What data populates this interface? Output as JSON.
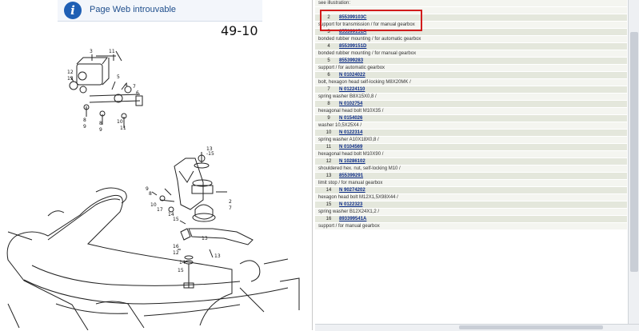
{
  "banner": {
    "message": "Page Web introuvable",
    "icon": "info-icon"
  },
  "diagram": {
    "page_label": "49-10"
  },
  "parts": {
    "intro": "see illustration:",
    "items": [
      {
        "num": "2",
        "part": "855399103C",
        "desc": "support for transmission / for manual gearbox"
      },
      {
        "num": "3",
        "part": "855399151A",
        "desc": "bonded rubber mounting / for automatic gearbox"
      },
      {
        "num": "4",
        "part": "855399151D",
        "desc": "bonded rubber mounting / for manual gearbox"
      },
      {
        "num": "5",
        "part": "855399283",
        "desc": "support / for automatic gearbox"
      },
      {
        "num": "6",
        "part": "N 01024022",
        "desc": "bolt, hexagon head self-locking M8X20MK /"
      },
      {
        "num": "7",
        "part": "N 01224110",
        "desc": "spring washer B8X15X0,8 /"
      },
      {
        "num": "8",
        "part": "N 0102754",
        "desc": "hexagonal head bolt M10X35 /"
      },
      {
        "num": "9",
        "part": "N 0154026",
        "desc": "washer 10,5X25X4 /"
      },
      {
        "num": "10",
        "part": "N 0122314",
        "desc": "spring washer A10X18X0,8 /"
      },
      {
        "num": "11",
        "part": "N 0104569",
        "desc": "hexagonal head bolt M10X90 /"
      },
      {
        "num": "12",
        "part": "N 10286102",
        "desc": "shouldered hex. nut, self-locking M10 /"
      },
      {
        "num": "13",
        "part": "855399291",
        "desc": "limit stop / for manual gearbox"
      },
      {
        "num": "14",
        "part": "N 90274202",
        "desc": "hexagon head bolt M12X1,5X98X44 /"
      },
      {
        "num": "15",
        "part": "N 0122323",
        "desc": "spring washer B12X24X1,2 /"
      },
      {
        "num": "16",
        "part": "893399541A",
        "desc": "support / for manual gearbox"
      }
    ]
  },
  "colors": {
    "highlight": "#d21c1c",
    "link": "#0a2a88",
    "row_num_bg": "#e4e7dc"
  }
}
